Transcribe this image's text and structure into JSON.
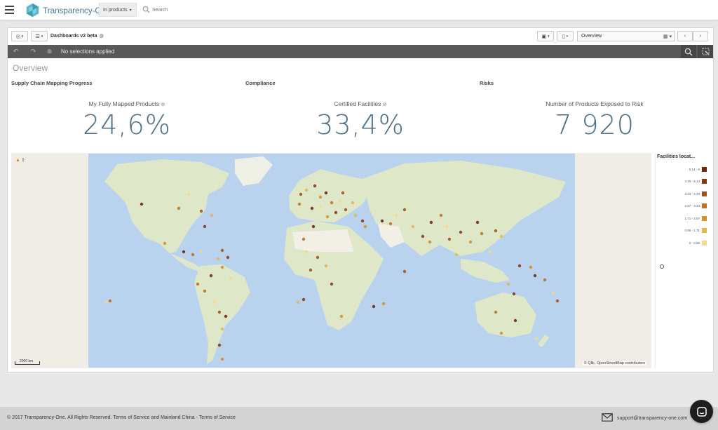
{
  "nav": {
    "logo_text": "Transparency-One",
    "scope_label": "In products",
    "search_placeholder": "Search"
  },
  "toolbar": {
    "app_title": "Dashboards v2 beta",
    "sheet_name": "Overview"
  },
  "selections": {
    "text": "No selections applied"
  },
  "sheet": {
    "title": "Overview"
  },
  "kpis": [
    {
      "section": "Supply Chain Mapping Progress",
      "label": "My Fully Mapped Products",
      "value": "24,6%"
    },
    {
      "section": "Compliance",
      "label": "Certified Facilities",
      "value": "33,4%"
    },
    {
      "section": "Risks",
      "label": "Number of Products Exposed to Risk",
      "value": "7 920"
    }
  ],
  "map": {
    "warning_count": "1",
    "scale_label": "2000 km",
    "attribution": "© Qlik, OpenStreetMap contributors",
    "colors": {
      "ocean": "#b9d3ef",
      "land": "#dfe7c9",
      "desert": "#f2efe6"
    }
  },
  "legend": {
    "title": "Facilities locat...",
    "items": [
      {
        "label": "5.14 - 6",
        "color": "#6b2a10"
      },
      {
        "label": "4.29 - 5.14",
        "color": "#8a3a13"
      },
      {
        "label": "3.43 - 4.29",
        "color": "#a64f18"
      },
      {
        "label": "2.57 - 3.43",
        "color": "#c2701f"
      },
      {
        "label": "1.71 - 2.57",
        "color": "#d68e2a"
      },
      {
        "label": "0.86 - 1.71",
        "color": "#e7b74c"
      },
      {
        "label": "0 - 0.86",
        "color": "#f1d88a"
      }
    ]
  },
  "footer": {
    "copyright": "© 2017 Transparency-One. All Rights Reserved.",
    "tos": "Terms of Service",
    "and_text": "and",
    "china_tos": "Mainland China - Terms of Service",
    "email": "support@transparency-one.com"
  }
}
